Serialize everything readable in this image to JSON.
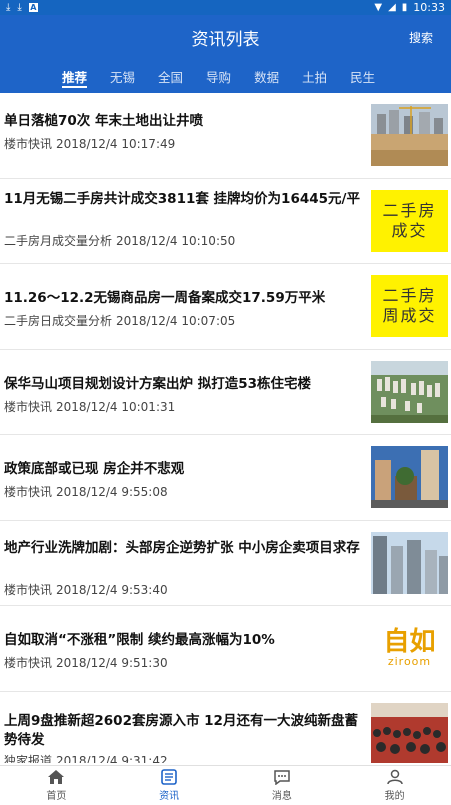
{
  "status": {
    "time": "10:33"
  },
  "header": {
    "title": "资讯列表",
    "search_label": "搜索"
  },
  "tabs": [
    {
      "label": "推荐"
    },
    {
      "label": "无锡"
    },
    {
      "label": "全国"
    },
    {
      "label": "导购"
    },
    {
      "label": "数据"
    },
    {
      "label": "土拍"
    },
    {
      "label": "民生"
    }
  ],
  "news": [
    {
      "title": "单日落槌70次 年末土地出让井喷",
      "source": "楼市快讯",
      "time": "2018/12/4 10:17:49",
      "thumb": "construction-photo"
    },
    {
      "title": "11月无锡二手房共计成交3811套 挂牌均价为16445元/平",
      "source": "二手房月成交量分析",
      "time": "2018/12/4 10:10:50",
      "thumb": "yellow-card",
      "thumb_line1": "二手房",
      "thumb_line2": "成交"
    },
    {
      "title": "11.26～12.2无锡商品房一周备案成交17.59万平米",
      "source": "二手房日成交量分析",
      "time": "2018/12/4 10:07:05",
      "thumb": "yellow-card",
      "thumb_line1": "二手房",
      "thumb_line2": "周成交"
    },
    {
      "title": "保华马山项目规划设计方案出炉 拟打造53栋住宅楼",
      "source": "楼市快讯",
      "time": "2018/12/4 10:01:31",
      "thumb": "aerial-render-photo"
    },
    {
      "title": "政策底部或已现 房企并不悲观",
      "source": "楼市快讯",
      "time": "2018/12/4 9:55:08",
      "thumb": "city-street-photo"
    },
    {
      "title": "地产行业洗牌加剧：头部房企逆势扩张 中小房企卖项目求存",
      "source": "楼市快讯",
      "time": "2018/12/4 9:53:40",
      "thumb": "towers-photo"
    },
    {
      "title": "自如取消“不涨租”限制 续约最高涨幅为10%",
      "source": "楼市快讯",
      "time": "2018/12/4 9:51:30",
      "thumb": "ziroom-logo",
      "thumb_line1": "自如",
      "thumb_line2": "ziroom"
    },
    {
      "title": "上周9盘推新超2602套房源入市 12月还有一大波纯新盘蓄势待发",
      "source": "独家报道",
      "time": "2018/12/4 9:31:42",
      "thumb": "crowd-photo"
    }
  ],
  "bottom_nav": [
    {
      "label": "首页",
      "icon": "home-icon"
    },
    {
      "label": "资讯",
      "icon": "news-icon"
    },
    {
      "label": "消息",
      "icon": "message-icon"
    },
    {
      "label": "我的",
      "icon": "user-icon"
    }
  ],
  "colors": {
    "primary": "#1e64c8",
    "statusbar": "#1565c0",
    "yellow": "#fff200"
  }
}
